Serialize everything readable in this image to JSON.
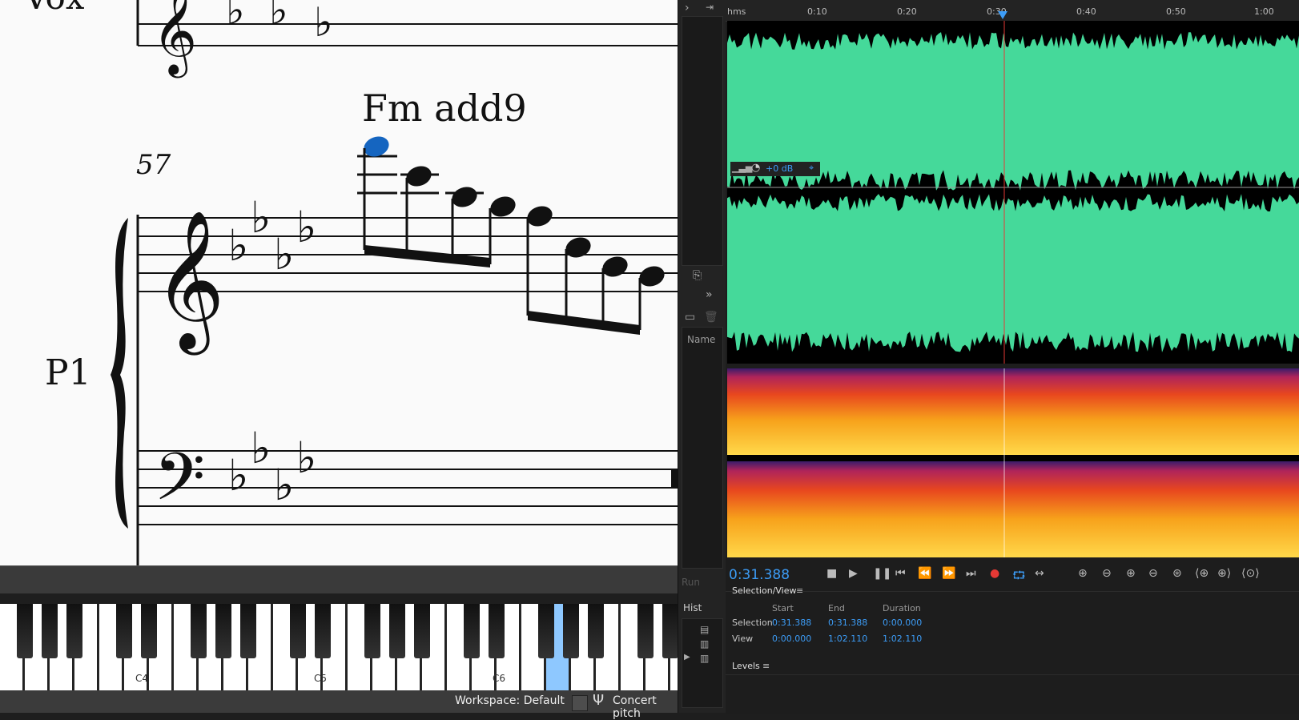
{
  "score": {
    "vox_label": "Vox",
    "part_label": "P1",
    "measure_number": "57",
    "chord_symbol": "Fm add9"
  },
  "piano": {
    "labels": {
      "c4": "C4",
      "c5": "C5",
      "c6": "C6"
    },
    "highlighted_key": "G6"
  },
  "statusbar": {
    "workspace": "Workspace: Default",
    "concert_pitch": "Concert pitch"
  },
  "mid": {
    "name_col": "Name",
    "run_label": "Run",
    "history_label": "Hist"
  },
  "audition": {
    "ruler": {
      "unit": "hms",
      "ticks": [
        "0:10",
        "0:20",
        "0:30",
        "0:40",
        "0:50",
        "1:00"
      ]
    },
    "gain": "+0 dB",
    "current_time": "0:31.388",
    "waveform_color": "#45d99a",
    "selection_view": {
      "title": "Selection/View",
      "headers": {
        "start": "Start",
        "end": "End",
        "duration": "Duration"
      },
      "rows": [
        {
          "label": "Selection",
          "start": "0:31.388",
          "end": "0:31.388",
          "duration": "0:00.000"
        },
        {
          "label": "View",
          "start": "0:00.000",
          "end": "1:02.110",
          "duration": "1:02.110"
        }
      ]
    },
    "levels_title": "Levels"
  }
}
